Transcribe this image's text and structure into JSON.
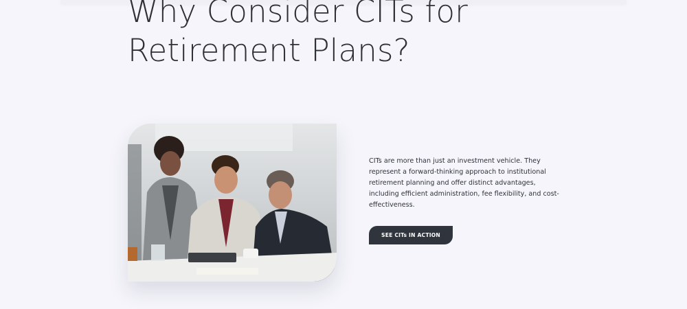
{
  "section": {
    "headline": "Why Consider CITs for Retirement Plans?",
    "body": "CITs are more than just an investment vehicle. They represent a forward-thinking approach to institutional retirement planning and offer distinct advantages, including efficient administration, fee flexibility, and cost-effectiveness.",
    "cta_label": "SEE CITs IN ACTION"
  },
  "colors": {
    "page_background": "#f5f5fb",
    "heading_text": "#2e3036",
    "body_text": "#2f323a",
    "button_background": "#2f343d",
    "button_text": "#ffffff"
  }
}
